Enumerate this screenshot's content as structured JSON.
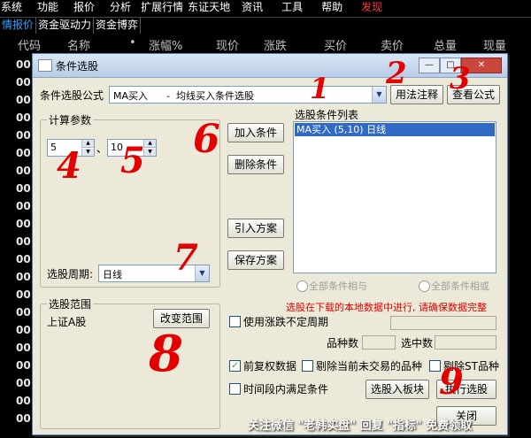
{
  "menubar": {
    "items": [
      "系统",
      "功能",
      "报价",
      "分析",
      "扩展行情",
      "东证天地",
      "资讯",
      "工具",
      "帮助",
      "发现"
    ],
    "highlight_color": "#ff3b3b"
  },
  "tabbar": {
    "tabs": [
      "情报价",
      "资金驱动力",
      "资金博弈"
    ]
  },
  "table_header": {
    "columns": [
      "代码",
      "名称",
      "•",
      "涨幅%",
      "现价",
      "涨跌",
      "买价",
      "卖价",
      "总量",
      "现量"
    ]
  },
  "left_codes": [
    "00",
    "00",
    "00",
    "00",
    "00",
    "00",
    "00",
    "00",
    "00",
    "00",
    "00",
    "00",
    "00",
    "00",
    "00",
    "00",
    "00",
    "00",
    "00",
    "00",
    "00"
  ],
  "dialog": {
    "title": "条件选股",
    "title_buttons": [
      "—",
      "□",
      "✕"
    ],
    "formula_label": "条件选股公式",
    "formula_value": "MA买入      -  均线买入条件选股",
    "usage_button": "用法注释",
    "view_formula_button": "查看公式",
    "calc_params_title": "计算参数",
    "param1": "5",
    "param_sep": "、",
    "param2": "10",
    "add_condition_button": "加入条件",
    "delete_condition_button": "删除条件",
    "import_scheme_button": "引入方案",
    "save_scheme_button": "保存方案",
    "condition_list_title": "选股条件列表",
    "condition_items": [
      "MA买入 (5,10) 日线"
    ],
    "period_label": "选股周期:",
    "period_value": "日线",
    "radio_and": "全部条件相与",
    "radio_or": "全部条件相或",
    "warning_text": "选股在下载的本地数据中进行, 请确保数据完整",
    "scope_title": "选股范围",
    "scope_value": "上证A股",
    "change_scope_button": "改变范围",
    "use_unfixed_period": "使用涨跌不定周期",
    "count_label": "品种数",
    "selected_label": "选中数",
    "prev_rights": "前复权数据",
    "exclude_untraded": "剔除当前未交易的品种",
    "exclude_st": "剔除ST品种",
    "time_range": "时间段内满足条件",
    "select_to_block_button": "选股入板块",
    "execute_button": "执行选股",
    "close_button": "关闭"
  },
  "annotations": [
    "1",
    "2",
    "3",
    "4",
    "5",
    "6",
    "7",
    "8",
    "9"
  ],
  "watermark": "关注微信 \"老韩实盘\" 回复 \"指标\" 免费领取"
}
